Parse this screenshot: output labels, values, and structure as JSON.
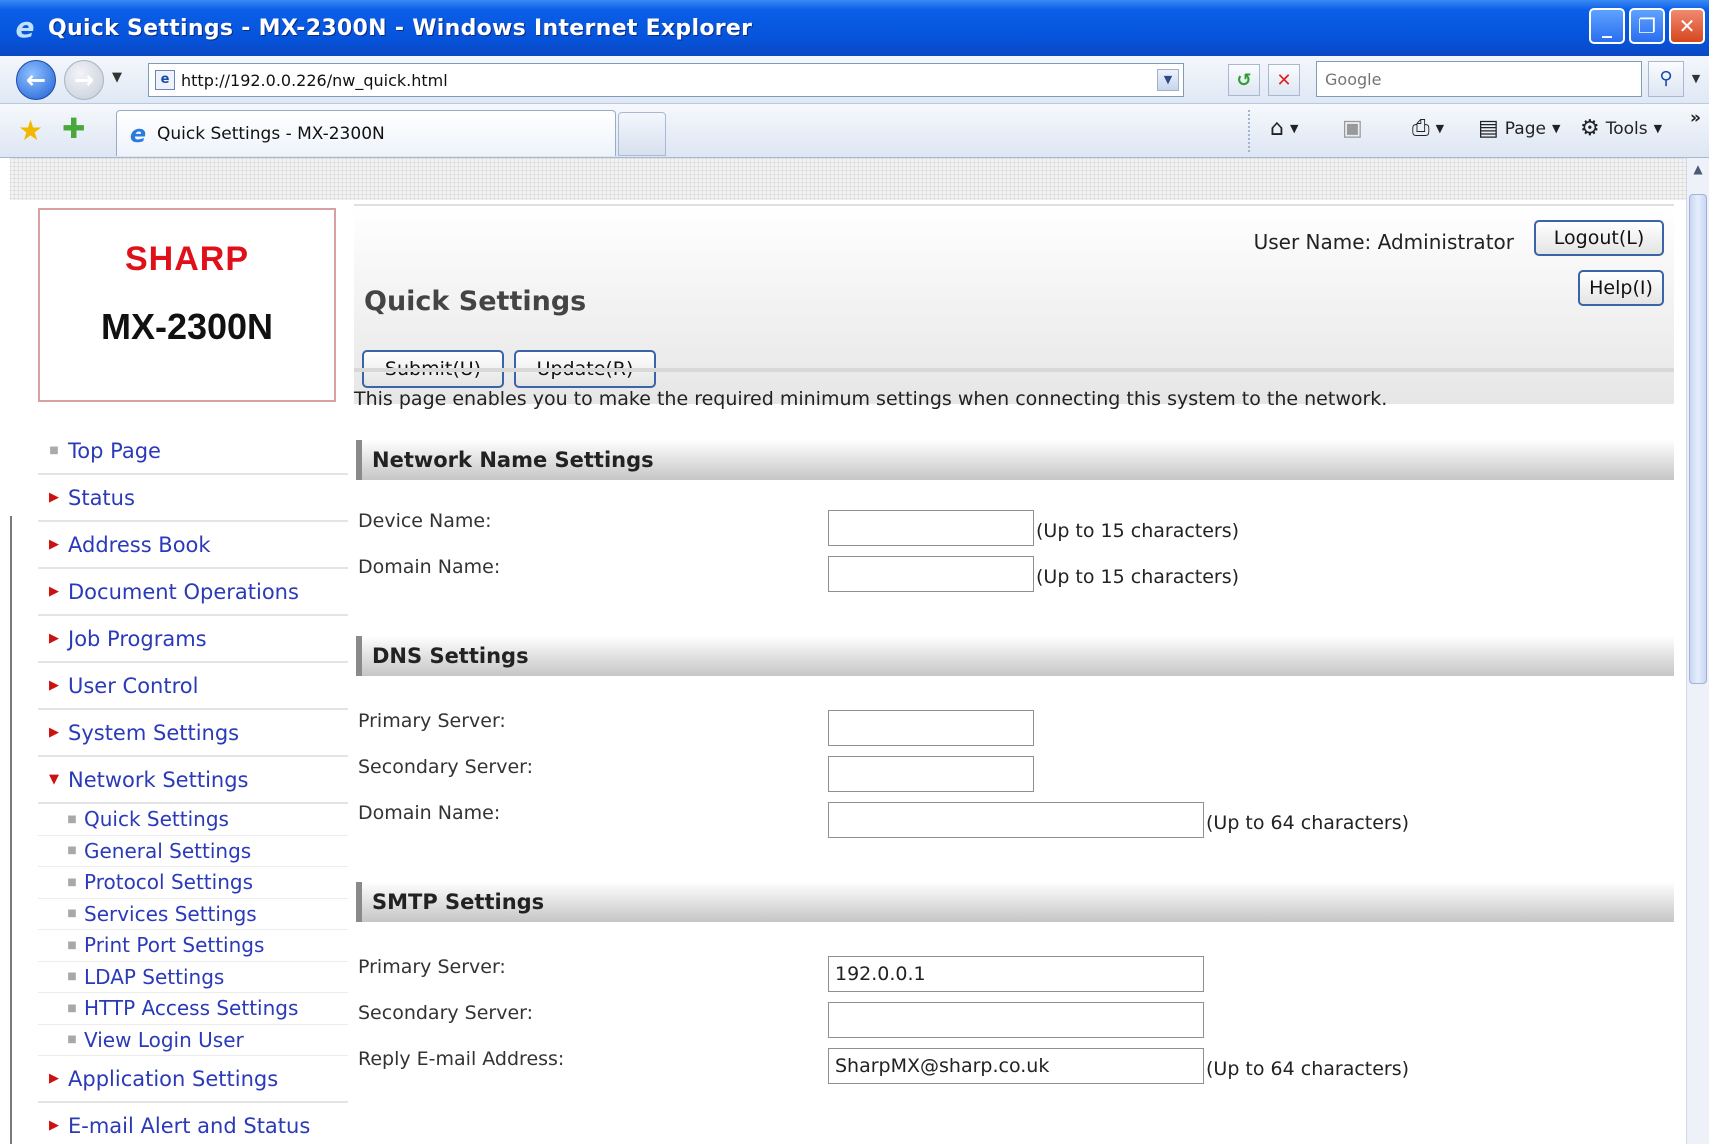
{
  "window": {
    "title": "Quick Settings - MX-2300N - Windows Internet Explorer",
    "buttons": {
      "minimize": "_",
      "restore": "❐",
      "close": "✕"
    }
  },
  "browser": {
    "url": "http://192.0.0.226/nw_quick.html",
    "search_placeholder": "Google",
    "tab_title": "Quick Settings - MX-2300N",
    "commands": {
      "page": "Page",
      "tools": "Tools"
    }
  },
  "logo": {
    "brand": "SHARP",
    "model": "MX-2300N"
  },
  "sidebar": {
    "items": [
      {
        "label": "Top Page",
        "mark": "■"
      },
      {
        "label": "Status",
        "mark": "▶"
      },
      {
        "label": "Address Book",
        "mark": "▶"
      },
      {
        "label": "Document Operations",
        "mark": "▶"
      },
      {
        "label": "Job Programs",
        "mark": "▶"
      },
      {
        "label": "User Control",
        "mark": "▶"
      },
      {
        "label": "System Settings",
        "mark": "▶"
      },
      {
        "label": "Network Settings",
        "mark": "▼"
      }
    ],
    "network_sub": [
      "Quick Settings",
      "General Settings",
      "Protocol Settings",
      "Services Settings",
      "Print Port Settings",
      "LDAP Settings",
      "HTTP Access Settings",
      "View Login User"
    ],
    "after": [
      {
        "label": "Application Settings",
        "mark": "▶"
      },
      {
        "label": "E-mail Alert and Status",
        "mark": "▶"
      }
    ]
  },
  "header": {
    "user_label": "User Name: Administrator",
    "logout": "Logout(L)",
    "help": "Help(I)",
    "title": "Quick Settings",
    "submit": "Submit(U)",
    "update": "Update(R)"
  },
  "intro": "This page enables you to make the required minimum settings when connecting this system to the network.",
  "sections": {
    "network_name": {
      "title": "Network Name Settings",
      "device_name": {
        "label": "Device Name:",
        "value": "",
        "hint": "(Up to 15 characters)"
      },
      "domain_name": {
        "label": "Domain Name:",
        "value": "",
        "hint": "(Up to 15 characters)"
      }
    },
    "dns": {
      "title": "DNS Settings",
      "primary": {
        "label": "Primary Server:",
        "value": ""
      },
      "secondary": {
        "label": "Secondary Server:",
        "value": ""
      },
      "domain": {
        "label": "Domain Name:",
        "value": "",
        "hint": "(Up to 64 characters)"
      }
    },
    "smtp": {
      "title": "SMTP Settings",
      "primary": {
        "label": "Primary Server:",
        "value": "192.0.0.1"
      },
      "secondary": {
        "label": "Secondary Server:",
        "value": ""
      },
      "reply": {
        "label": "Reply E-mail Address:",
        "value": "SharpMX@sharp.co.uk",
        "hint": "(Up to 64 characters)"
      }
    }
  },
  "colors": {
    "accent": "#2a3ab8",
    "brand_red": "#e0101a",
    "titlebar": "#0653da"
  }
}
